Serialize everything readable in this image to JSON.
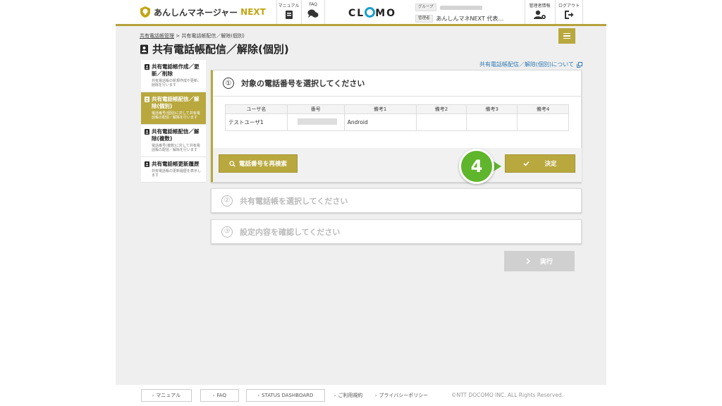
{
  "header": {
    "brand_main": "あんしんマネージャー",
    "brand_next": "NEXT",
    "manual_label": "マニュアル",
    "faq_label": "FAQ",
    "clomo_left": "CL",
    "clomo_right": "MO",
    "group_tag": "グループ",
    "admin_tag": "管理者",
    "admin_value": "あんしんマネNEXT 代表…",
    "admin_info_label": "管理者情報",
    "logout_label": "ログアウト"
  },
  "breadcrumb": {
    "parent": "共有電話帳管理",
    "separator": ">",
    "current": "共有電話帳配信／解除(個別)"
  },
  "page_title": "共有電話帳配信／解除(個別)",
  "help_link": "共有電話帳配信／解除(個別)について",
  "sidebar": {
    "items": [
      {
        "title": "共有電話帳作成／更新／削除",
        "desc": "共有電話帳の新規作成や更新、削除を行います"
      },
      {
        "title": "共有電話帳配信／解除(個別)",
        "desc": "電話番号(個別)に対して共有電話帳の配信／解除を行います"
      },
      {
        "title": "共有電話帳配信／解除(複数)",
        "desc": "電話番号(複数)に対して共有電話帳の配信／解除を行います"
      },
      {
        "title": "共有電話帳更新履歴",
        "desc": "共有電話帳の更新履歴を表示します"
      }
    ]
  },
  "step1": {
    "number": "①",
    "title": "対象の電話番号を選択してください",
    "table": {
      "headers": [
        "ユーザ名",
        "番号",
        "備考1",
        "備考2",
        "備考3",
        "備考4"
      ],
      "rows": [
        [
          "テストユーザ1",
          "",
          "Android",
          "",
          "",
          ""
        ]
      ]
    },
    "research_button": "電話番号を再検索",
    "decide_button": "決定"
  },
  "step2": {
    "number": "②",
    "title": "共有電話帳を選択してください"
  },
  "step3": {
    "number": "③",
    "title": "設定内容を確認してください"
  },
  "run_button": "実行",
  "step_badge": "4",
  "footer": {
    "manual": "マニュアル",
    "faq": "FAQ",
    "status": "STATUS DASHBOARD",
    "terms": "ご利用規約",
    "privacy": "プライバシーポリシー",
    "copyright": "©NTT DOCOMO INC. ALL Rights Reserved."
  },
  "colors": {
    "accent": "#b8a83e",
    "badge": "#5fb52b",
    "link": "#2e7ab5"
  }
}
